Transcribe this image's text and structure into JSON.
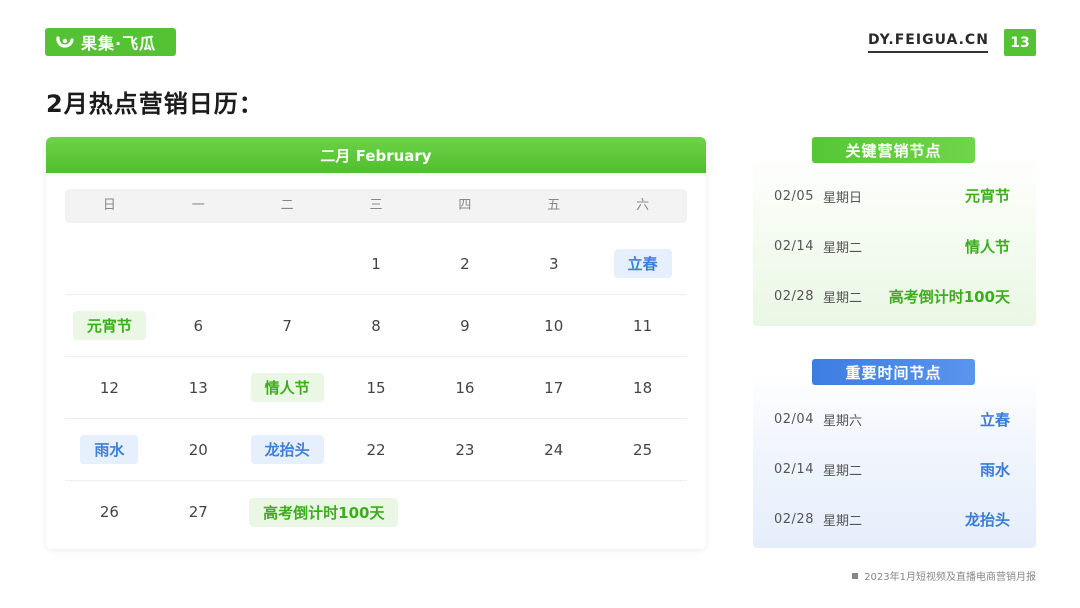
{
  "header": {
    "logo_text": "果集·飞瓜",
    "site_url": "DY.FEIGUA.CN",
    "page_number": "13",
    "brand_color": "#55c234"
  },
  "title": "2月热点营销日历：",
  "calendar": {
    "month_title": "二月 February",
    "weekdays": [
      "日",
      "一",
      "二",
      "三",
      "四",
      "五",
      "六"
    ],
    "rows": [
      [
        "",
        "",
        "",
        "1",
        "2",
        "3",
        "立春"
      ],
      [
        "元宵节",
        "6",
        "7",
        "8",
        "9",
        "10",
        "11"
      ],
      [
        "12",
        "13",
        "情人节",
        "15",
        "16",
        "17",
        "18"
      ],
      [
        "雨水",
        "20",
        "龙抬头",
        "22",
        "23",
        "24",
        "25"
      ],
      [
        "26",
        "27",
        "高考倒计时100天",
        "",
        "",
        "",
        ""
      ]
    ]
  },
  "key_marketing": {
    "badge": "关键营销节点",
    "events": [
      {
        "date": "02/05",
        "week": "星期日",
        "name": "元宵节"
      },
      {
        "date": "02/14",
        "week": "星期二",
        "name": "情人节"
      },
      {
        "date": "02/28",
        "week": "星期二",
        "name": "高考倒计时100天"
      }
    ]
  },
  "important_time": {
    "badge": "重要时间节点",
    "events": [
      {
        "date": "02/04",
        "week": "星期六",
        "name": "立春"
      },
      {
        "date": "02/14",
        "week": "星期二",
        "name": "雨水"
      },
      {
        "date": "02/28",
        "week": "星期二",
        "name": "龙抬头"
      }
    ]
  },
  "footer": "2023年1月短视频及直播电商营销月报",
  "icons": {
    "logo": "feigua-logo-icon",
    "footer_bullet": "square-bullet-icon"
  }
}
